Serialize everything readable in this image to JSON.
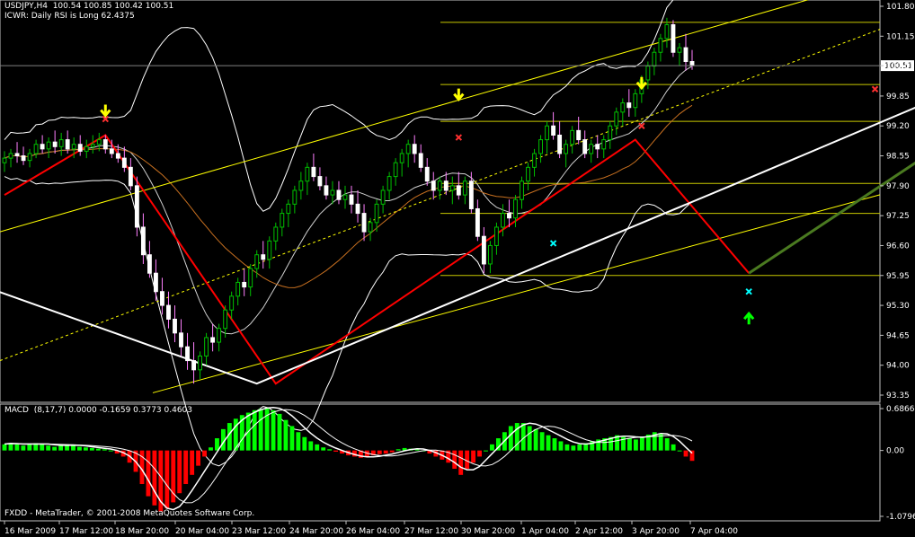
{
  "header": {
    "symbol_line": "USDJPY,H4  100.54 100.85 100.42 100.51",
    "indicator_line": "ICWR: Daily RSI is Long 62.4375"
  },
  "macd": {
    "label": "MACD  (8,17,7) 0.0000 -0.1659 0.3773 0.4603",
    "ticks": [
      "0.6866",
      "0.00",
      "-1.0796"
    ]
  },
  "footer": "FXDD - MetaTrader, © 2001-2008 MetaQuotes Software Corp.",
  "colors": {
    "background": "#000000",
    "grid_border": "#c0c0c0",
    "bull_candle": "#00c000",
    "bear_candle": "#ffffff",
    "fib_lines": "#c8c800",
    "zigzag_red": "#ff0000",
    "zigzag_white": "#ffffff",
    "channel": "#ffff00",
    "arrow_yellow": "#ffff00",
    "arrow_green": "#00ff00",
    "macd_pos": "#00ff00",
    "macd_neg": "#ff0000",
    "cross_red": "#ff3030",
    "cross_cyan": "#00ffff"
  },
  "chart_data": {
    "type": "candlestick",
    "symbol": "USDJPY",
    "timeframe": "H4",
    "current_price": 100.51,
    "y_ticks": [
      101.8,
      101.15,
      100.51,
      99.85,
      99.2,
      98.55,
      97.9,
      97.25,
      96.6,
      95.95,
      95.3,
      94.65,
      94.0,
      93.35
    ],
    "y_tick_labels": [
      "101.80",
      "101.15",
      "100.51",
      "99.85",
      "99.20",
      "98.55",
      "97.90",
      "97.25",
      "96.60",
      "95.95",
      "95.30",
      "94.65",
      "94.00",
      "93.35"
    ],
    "x_labels": [
      "16 Mar 2009",
      "17 Mar 12:00",
      "18 Mar 20:00",
      "20 Mar 04:00",
      "23 Mar 12:00",
      "24 Mar 20:00",
      "26 Mar 04:00",
      "27 Mar 12:00",
      "30 Mar 20:00",
      "1 Apr 04:00",
      "2 Apr 12:00",
      "3 Apr 20:00",
      "7 Apr 04:00"
    ],
    "fib_levels": [
      101.45,
      100.1,
      99.3,
      97.95,
      97.3,
      95.95
    ],
    "zigzag_red": [
      [
        0,
        97.7
      ],
      [
        16,
        99.0
      ],
      [
        43,
        93.6
      ],
      [
        100,
        98.9
      ],
      [
        118,
        96.0
      ]
    ],
    "zigzag_white": [
      [
        -2,
        95.65
      ],
      [
        40,
        93.6
      ],
      [
        116,
        97.95
      ],
      [
        178,
        101.55
      ]
    ],
    "candles": [
      {
        "o": 98.4,
        "h": 98.65,
        "l": 98.2,
        "c": 98.5
      },
      {
        "o": 98.5,
        "h": 98.7,
        "l": 98.3,
        "c": 98.6
      },
      {
        "o": 98.6,
        "h": 98.85,
        "l": 98.4,
        "c": 98.55
      },
      {
        "o": 98.55,
        "h": 98.75,
        "l": 98.35,
        "c": 98.45
      },
      {
        "o": 98.45,
        "h": 98.7,
        "l": 98.3,
        "c": 98.6
      },
      {
        "o": 98.6,
        "h": 98.9,
        "l": 98.5,
        "c": 98.8
      },
      {
        "o": 98.8,
        "h": 99.0,
        "l": 98.6,
        "c": 98.7
      },
      {
        "o": 98.7,
        "h": 98.95,
        "l": 98.5,
        "c": 98.85
      },
      {
        "o": 98.85,
        "h": 99.1,
        "l": 98.6,
        "c": 98.75
      },
      {
        "o": 98.75,
        "h": 99.05,
        "l": 98.55,
        "c": 98.9
      },
      {
        "o": 98.9,
        "h": 99.1,
        "l": 98.6,
        "c": 98.7
      },
      {
        "o": 98.7,
        "h": 98.95,
        "l": 98.5,
        "c": 98.8
      },
      {
        "o": 98.8,
        "h": 99.0,
        "l": 98.55,
        "c": 98.65
      },
      {
        "o": 98.65,
        "h": 98.9,
        "l": 98.5,
        "c": 98.75
      },
      {
        "o": 98.75,
        "h": 99.0,
        "l": 98.6,
        "c": 98.8
      },
      {
        "o": 98.8,
        "h": 99.05,
        "l": 98.65,
        "c": 98.9
      },
      {
        "o": 98.9,
        "h": 99.0,
        "l": 98.6,
        "c": 98.7
      },
      {
        "o": 98.7,
        "h": 98.9,
        "l": 98.5,
        "c": 98.6
      },
      {
        "o": 98.6,
        "h": 98.8,
        "l": 98.4,
        "c": 98.5
      },
      {
        "o": 98.5,
        "h": 98.75,
        "l": 98.2,
        "c": 98.3
      },
      {
        "o": 98.3,
        "h": 98.5,
        "l": 97.8,
        "c": 97.9
      },
      {
        "o": 97.9,
        "h": 98.1,
        "l": 96.8,
        "c": 97.0
      },
      {
        "o": 97.0,
        "h": 97.3,
        "l": 96.2,
        "c": 96.4
      },
      {
        "o": 96.4,
        "h": 96.7,
        "l": 95.9,
        "c": 96.0
      },
      {
        "o": 96.0,
        "h": 96.3,
        "l": 95.4,
        "c": 95.6
      },
      {
        "o": 95.6,
        "h": 95.9,
        "l": 95.1,
        "c": 95.3
      },
      {
        "o": 95.3,
        "h": 95.6,
        "l": 94.8,
        "c": 95.0
      },
      {
        "o": 95.0,
        "h": 95.3,
        "l": 94.5,
        "c": 94.7
      },
      {
        "o": 94.7,
        "h": 95.0,
        "l": 94.2,
        "c": 94.4
      },
      {
        "o": 94.4,
        "h": 94.7,
        "l": 93.9,
        "c": 94.1
      },
      {
        "o": 94.1,
        "h": 94.5,
        "l": 93.6,
        "c": 93.9
      },
      {
        "o": 93.9,
        "h": 94.3,
        "l": 93.7,
        "c": 94.2
      },
      {
        "o": 94.2,
        "h": 94.7,
        "l": 94.0,
        "c": 94.6
      },
      {
        "o": 94.6,
        "h": 94.9,
        "l": 94.3,
        "c": 94.5
      },
      {
        "o": 94.5,
        "h": 94.9,
        "l": 94.3,
        "c": 94.8
      },
      {
        "o": 94.8,
        "h": 95.3,
        "l": 94.6,
        "c": 95.2
      },
      {
        "o": 95.2,
        "h": 95.6,
        "l": 95.0,
        "c": 95.5
      },
      {
        "o": 95.5,
        "h": 95.9,
        "l": 95.3,
        "c": 95.8
      },
      {
        "o": 95.8,
        "h": 96.1,
        "l": 95.5,
        "c": 95.7
      },
      {
        "o": 95.7,
        "h": 96.2,
        "l": 95.5,
        "c": 96.1
      },
      {
        "o": 96.1,
        "h": 96.5,
        "l": 95.9,
        "c": 96.4
      },
      {
        "o": 96.4,
        "h": 96.7,
        "l": 96.1,
        "c": 96.3
      },
      {
        "o": 96.3,
        "h": 96.8,
        "l": 96.1,
        "c": 96.7
      },
      {
        "o": 96.7,
        "h": 97.1,
        "l": 96.5,
        "c": 97.0
      },
      {
        "o": 97.0,
        "h": 97.4,
        "l": 96.8,
        "c": 97.3
      },
      {
        "o": 97.3,
        "h": 97.6,
        "l": 97.0,
        "c": 97.5
      },
      {
        "o": 97.5,
        "h": 97.9,
        "l": 97.3,
        "c": 97.8
      },
      {
        "o": 97.8,
        "h": 98.2,
        "l": 97.6,
        "c": 98.0
      },
      {
        "o": 98.0,
        "h": 98.4,
        "l": 97.7,
        "c": 98.3
      },
      {
        "o": 98.3,
        "h": 98.6,
        "l": 98.0,
        "c": 98.1
      },
      {
        "o": 98.1,
        "h": 98.3,
        "l": 97.8,
        "c": 97.9
      },
      {
        "o": 97.9,
        "h": 98.1,
        "l": 97.6,
        "c": 97.7
      },
      {
        "o": 97.7,
        "h": 98.0,
        "l": 97.5,
        "c": 97.8
      },
      {
        "o": 97.8,
        "h": 98.0,
        "l": 97.5,
        "c": 97.6
      },
      {
        "o": 97.6,
        "h": 97.9,
        "l": 97.4,
        "c": 97.7
      },
      {
        "o": 97.7,
        "h": 97.9,
        "l": 97.3,
        "c": 97.5
      },
      {
        "o": 97.5,
        "h": 97.8,
        "l": 97.1,
        "c": 97.3
      },
      {
        "o": 97.3,
        "h": 97.5,
        "l": 96.7,
        "c": 96.9
      },
      {
        "o": 96.9,
        "h": 97.2,
        "l": 96.7,
        "c": 97.1
      },
      {
        "o": 97.1,
        "h": 97.6,
        "l": 96.9,
        "c": 97.5
      },
      {
        "o": 97.5,
        "h": 97.9,
        "l": 97.3,
        "c": 97.8
      },
      {
        "o": 97.8,
        "h": 98.2,
        "l": 97.6,
        "c": 98.1
      },
      {
        "o": 98.1,
        "h": 98.5,
        "l": 97.9,
        "c": 98.4
      },
      {
        "o": 98.4,
        "h": 98.7,
        "l": 98.1,
        "c": 98.6
      },
      {
        "o": 98.6,
        "h": 98.9,
        "l": 98.3,
        "c": 98.8
      },
      {
        "o": 98.8,
        "h": 99.0,
        "l": 98.4,
        "c": 98.6
      },
      {
        "o": 98.6,
        "h": 98.8,
        "l": 98.2,
        "c": 98.3
      },
      {
        "o": 98.3,
        "h": 98.5,
        "l": 97.9,
        "c": 98.0
      },
      {
        "o": 98.0,
        "h": 98.2,
        "l": 97.6,
        "c": 97.8
      },
      {
        "o": 97.8,
        "h": 98.1,
        "l": 97.6,
        "c": 98.0
      },
      {
        "o": 98.0,
        "h": 98.2,
        "l": 97.7,
        "c": 97.8
      },
      {
        "o": 97.8,
        "h": 98.1,
        "l": 97.5,
        "c": 97.9
      },
      {
        "o": 97.9,
        "h": 98.2,
        "l": 97.6,
        "c": 97.7
      },
      {
        "o": 97.7,
        "h": 98.1,
        "l": 97.5,
        "c": 98.0
      },
      {
        "o": 98.0,
        "h": 98.2,
        "l": 97.3,
        "c": 97.4
      },
      {
        "o": 97.4,
        "h": 97.6,
        "l": 96.7,
        "c": 96.8
      },
      {
        "o": 96.8,
        "h": 97.0,
        "l": 96.0,
        "c": 96.2
      },
      {
        "o": 96.2,
        "h": 96.7,
        "l": 96.0,
        "c": 96.6
      },
      {
        "o": 96.6,
        "h": 97.1,
        "l": 96.4,
        "c": 97.0
      },
      {
        "o": 97.0,
        "h": 97.5,
        "l": 96.8,
        "c": 97.3
      },
      {
        "o": 97.3,
        "h": 97.6,
        "l": 97.0,
        "c": 97.2
      },
      {
        "o": 97.2,
        "h": 97.7,
        "l": 97.0,
        "c": 97.6
      },
      {
        "o": 97.6,
        "h": 98.1,
        "l": 97.4,
        "c": 98.0
      },
      {
        "o": 98.0,
        "h": 98.4,
        "l": 97.8,
        "c": 98.3
      },
      {
        "o": 98.3,
        "h": 98.7,
        "l": 98.1,
        "c": 98.6
      },
      {
        "o": 98.6,
        "h": 99.0,
        "l": 98.4,
        "c": 98.9
      },
      {
        "o": 98.9,
        "h": 99.3,
        "l": 98.6,
        "c": 99.2
      },
      {
        "o": 99.2,
        "h": 99.5,
        "l": 98.9,
        "c": 99.0
      },
      {
        "o": 99.0,
        "h": 99.3,
        "l": 98.5,
        "c": 98.6
      },
      {
        "o": 98.6,
        "h": 98.9,
        "l": 98.3,
        "c": 98.8
      },
      {
        "o": 98.8,
        "h": 99.2,
        "l": 98.6,
        "c": 99.1
      },
      {
        "o": 99.1,
        "h": 99.4,
        "l": 98.8,
        "c": 98.9
      },
      {
        "o": 98.9,
        "h": 99.1,
        "l": 98.5,
        "c": 98.6
      },
      {
        "o": 98.6,
        "h": 98.9,
        "l": 98.4,
        "c": 98.8
      },
      {
        "o": 98.8,
        "h": 99.0,
        "l": 98.5,
        "c": 98.7
      },
      {
        "o": 98.7,
        "h": 99.0,
        "l": 98.5,
        "c": 98.9
      },
      {
        "o": 98.9,
        "h": 99.3,
        "l": 98.7,
        "c": 99.2
      },
      {
        "o": 99.2,
        "h": 99.6,
        "l": 99.0,
        "c": 99.5
      },
      {
        "o": 99.5,
        "h": 99.8,
        "l": 99.2,
        "c": 99.7
      },
      {
        "o": 99.7,
        "h": 100.0,
        "l": 99.4,
        "c": 99.6
      },
      {
        "o": 99.6,
        "h": 100.0,
        "l": 99.4,
        "c": 99.9
      },
      {
        "o": 99.9,
        "h": 100.3,
        "l": 99.7,
        "c": 100.2
      },
      {
        "o": 100.2,
        "h": 100.6,
        "l": 100.0,
        "c": 100.5
      },
      {
        "o": 100.5,
        "h": 100.9,
        "l": 100.3,
        "c": 100.8
      },
      {
        "o": 100.8,
        "h": 101.2,
        "l": 100.6,
        "c": 101.1
      },
      {
        "o": 101.1,
        "h": 101.55,
        "l": 100.9,
        "c": 101.4
      },
      {
        "o": 101.4,
        "h": 101.5,
        "l": 100.7,
        "c": 100.8
      },
      {
        "o": 100.8,
        "h": 101.0,
        "l": 100.5,
        "c": 100.9
      },
      {
        "o": 100.9,
        "h": 101.2,
        "l": 100.4,
        "c": 100.6
      },
      {
        "o": 100.6,
        "h": 100.85,
        "l": 100.42,
        "c": 100.51
      }
    ],
    "macd_histogram": [
      0.1,
      0.12,
      0.1,
      0.08,
      0.1,
      0.12,
      0.1,
      0.08,
      0.06,
      0.08,
      0.1,
      0.08,
      0.06,
      0.05,
      0.04,
      0.03,
      0.02,
      0.0,
      -0.05,
      -0.1,
      -0.2,
      -0.35,
      -0.55,
      -0.75,
      -0.9,
      -1.0,
      -0.95,
      -0.85,
      -0.7,
      -0.55,
      -0.4,
      -0.25,
      -0.1,
      0.05,
      0.2,
      0.35,
      0.45,
      0.52,
      0.58,
      0.62,
      0.66,
      0.68,
      0.69,
      0.66,
      0.6,
      0.5,
      0.4,
      0.3,
      0.22,
      0.15,
      0.1,
      0.05,
      0.02,
      -0.02,
      -0.05,
      -0.08,
      -0.1,
      -0.12,
      -0.1,
      -0.08,
      -0.06,
      -0.05,
      -0.03,
      0.02,
      0.04,
      0.03,
      0.02,
      0.0,
      -0.05,
      -0.1,
      -0.15,
      -0.2,
      -0.3,
      -0.4,
      -0.3,
      -0.2,
      -0.1,
      0.0,
      0.1,
      0.2,
      0.3,
      0.4,
      0.45,
      0.45,
      0.4,
      0.35,
      0.3,
      0.25,
      0.2,
      0.15,
      0.1,
      0.08,
      0.1,
      0.12,
      0.15,
      0.18,
      0.2,
      0.22,
      0.25,
      0.22,
      0.2,
      0.18,
      0.22,
      0.26,
      0.3,
      0.28,
      0.2,
      0.1,
      0.0,
      -0.1,
      -0.17
    ]
  }
}
